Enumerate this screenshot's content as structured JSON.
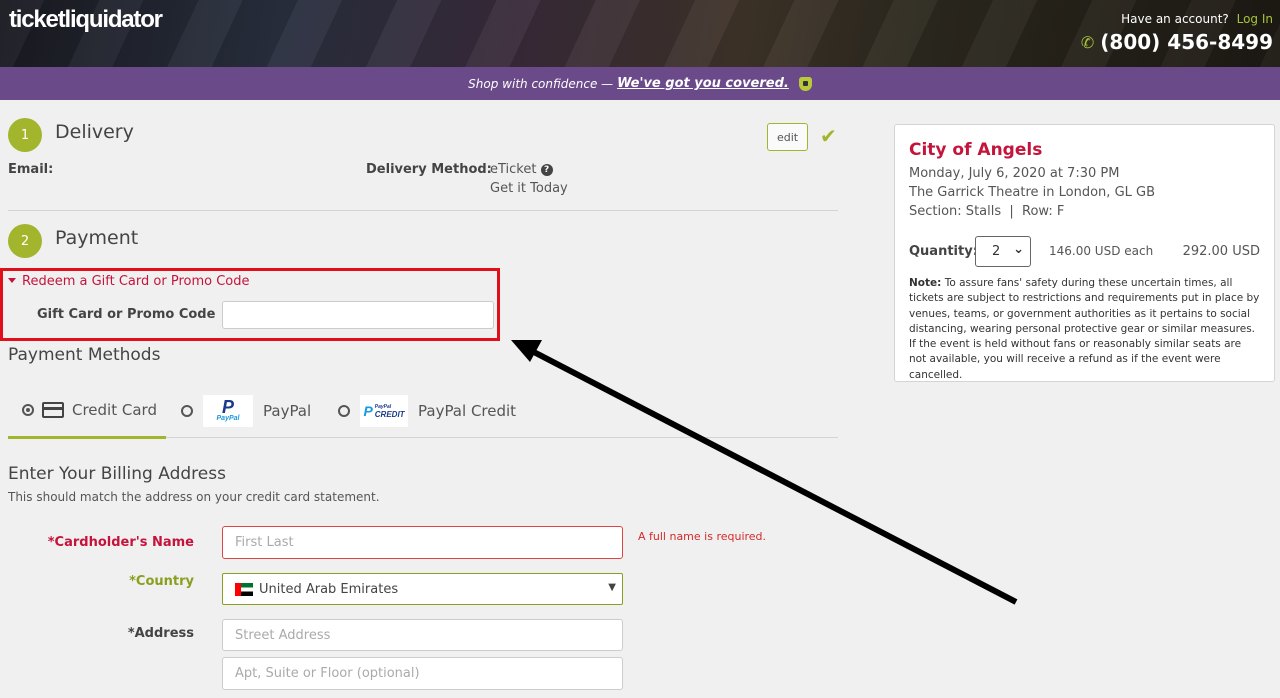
{
  "header": {
    "logo": "ticketliquidator",
    "account_prompt": "Have an account?",
    "login_label": "Log In",
    "phone": "(800) 456-8499"
  },
  "banner": {
    "text": "Shop with confidence —",
    "link": "We've got you covered."
  },
  "delivery": {
    "step": "1",
    "title": "Delivery",
    "edit_label": "edit",
    "email_label": "Email:",
    "method_label": "Delivery Method:",
    "method_value": "eTicket",
    "method_note": "Get it Today"
  },
  "payment": {
    "step": "2",
    "title": "Payment",
    "redeem_link": "Redeem a Gift Card or Promo Code",
    "promo_label": "Gift Card or Promo Code",
    "promo_value": "",
    "methods_heading": "Payment Methods",
    "tabs": [
      {
        "label": "Credit Card",
        "selected": true
      },
      {
        "label": "PayPal",
        "selected": false
      },
      {
        "label": "PayPal Credit",
        "selected": false
      }
    ],
    "paypal_logo_text": "P",
    "paypal_logo_word": "PayPal",
    "paypal_credit_logo_p": "P",
    "paypal_credit_logo_t1": "PayPal",
    "paypal_credit_logo_t2": "CREDIT"
  },
  "billing": {
    "heading": "Enter Your Billing Address",
    "subheading": "This should match the address on your credit card statement.",
    "cardholder_label": "*Cardholder's Name",
    "cardholder_placeholder": "First Last",
    "cardholder_error": "A full name is required.",
    "country_label": "*Country",
    "country_value": "United Arab Emirates",
    "address_label": "*Address",
    "address_placeholder": "Street Address",
    "address2_placeholder": "Apt, Suite or Floor (optional)"
  },
  "order": {
    "event": "City of Angels",
    "date": "Monday, July 6, 2020 at 7:30 PM",
    "venue": "The Garrick Theatre in London, GL GB",
    "seating": "Section: Stalls  |  Row: F",
    "quantity_label": "Quantity:",
    "quantity": "2",
    "price_each": "146.00 USD each",
    "total": "292.00 USD",
    "note_label": "Note:",
    "note_text": "To assure fans' safety during these uncertain times, all tickets are subject to restrictions and requirements put in place by venues, teams, or government authorities as it pertains to social distancing, wearing personal protective gear or similar measures. If the event is held without fans or reasonably similar seats are not available, you will receive a refund as if the event were cancelled."
  },
  "colors": {
    "brand_purple": "#6b4a8a",
    "accent_green": "#a2b52c",
    "event_red": "#c4143c",
    "highlight_red": "#e0101a"
  }
}
